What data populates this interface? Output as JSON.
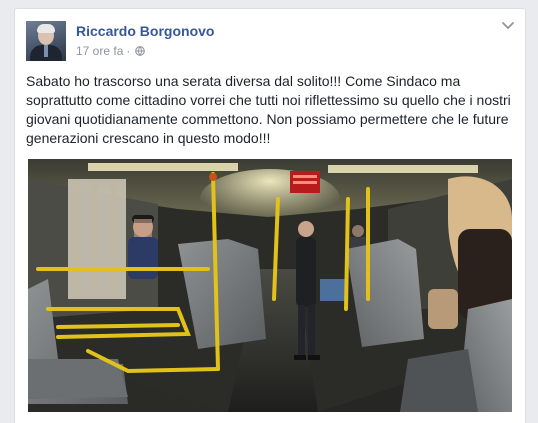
{
  "post": {
    "author": "Riccardo Borgonovo",
    "timestamp": "17 ore fa",
    "separator": "·",
    "privacy_icon": "globe-icon",
    "menu_icon": "chevron-down-icon",
    "text": "Sabato ho trascorso una serata diversa dal solito!!! Come Sindaco ma soprattutto come cittadino vorrei che tutti noi riflettessimo su quello che i nostri giovani quotidianamente commettono. Non possiamo permettere che le future generazioni crescano in questo modo!!!"
  },
  "colors": {
    "page_background": "#e9ebee",
    "author_link": "#365899",
    "meta_text": "#90949c",
    "body_text": "#1d2129",
    "bus_pole_yellow": "#e0c21a"
  }
}
